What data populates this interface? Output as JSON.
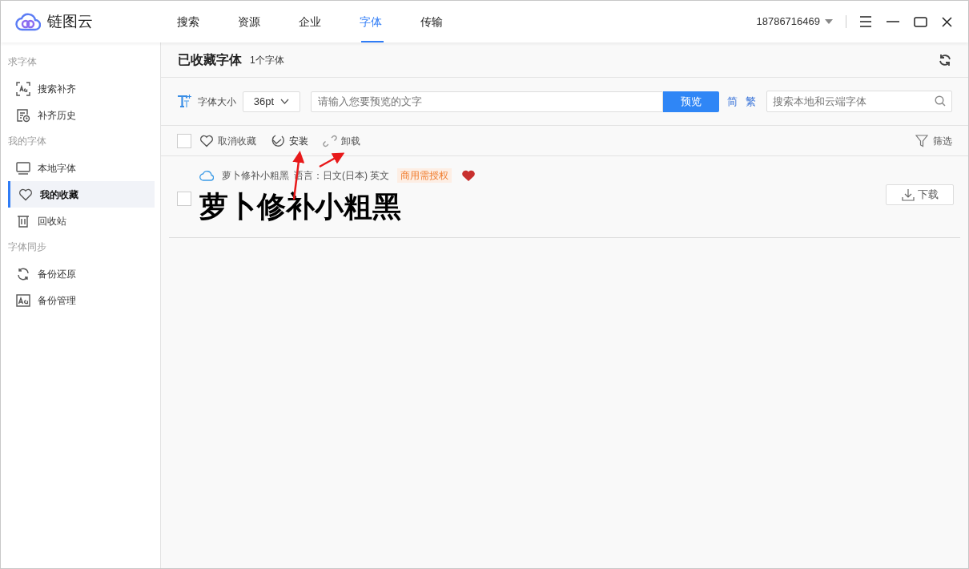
{
  "app": {
    "name": "链图云"
  },
  "nav": [
    {
      "label": "搜索",
      "selected": false
    },
    {
      "label": "资源",
      "selected": false
    },
    {
      "label": "企业",
      "selected": false
    },
    {
      "label": "字体",
      "selected": true
    },
    {
      "label": "传输",
      "selected": false
    }
  ],
  "account": "18786716469",
  "sidebar": [
    {
      "heading": "求字体",
      "items": [
        {
          "label": "搜索补齐",
          "selected": false
        },
        {
          "label": "补齐历史",
          "selected": false
        }
      ]
    },
    {
      "heading": "我的字体",
      "items": [
        {
          "label": "本地字体",
          "selected": false
        },
        {
          "label": "我的收藏",
          "selected": true
        },
        {
          "label": "回收站",
          "selected": false
        }
      ]
    },
    {
      "heading": "字体同步",
      "items": [
        {
          "label": "备份还原",
          "selected": false
        },
        {
          "label": "备份管理",
          "selected": false
        }
      ]
    }
  ],
  "page": {
    "title": "已收藏字体",
    "count": "1个字体"
  },
  "toolbar": {
    "size_label": "字体大小",
    "size": "36pt",
    "preview_placeholder": "请输入您要预览的文字",
    "preview_button": "预览",
    "simplified": "简",
    "traditional": "繁",
    "search_placeholder": "搜索本地和云端字体"
  },
  "actions": {
    "select_all_checked": false,
    "items": [
      {
        "label": "取消收藏"
      },
      {
        "label": "安装"
      },
      {
        "label": "卸载"
      }
    ],
    "filter": "筛选"
  },
  "fonts": [
    {
      "name": "萝卜修补小粗黑",
      "language": "语言：日文(日本) 英文",
      "license": "商用需授权",
      "favorite": true,
      "checked": false,
      "sample": "萝卜修补小粗黑",
      "download": "下载"
    }
  ]
}
